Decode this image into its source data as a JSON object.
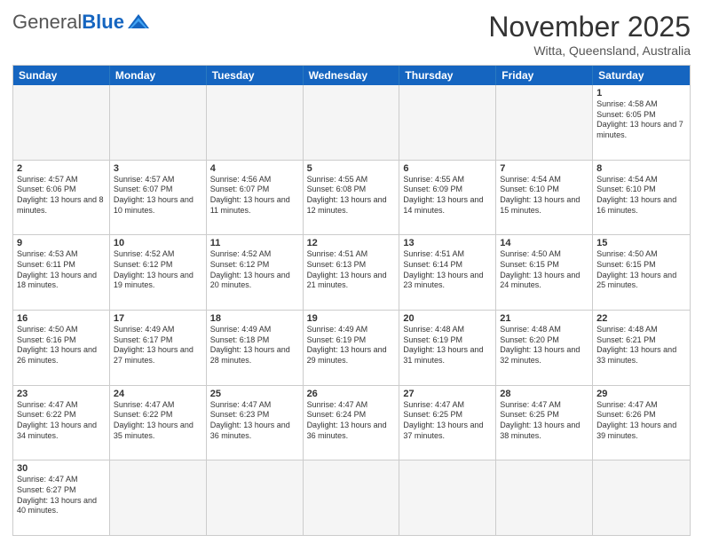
{
  "header": {
    "logo": {
      "general": "General",
      "blue": "Blue"
    },
    "title": "November 2025",
    "location": "Witta, Queensland, Australia"
  },
  "days_of_week": [
    "Sunday",
    "Monday",
    "Tuesday",
    "Wednesday",
    "Thursday",
    "Friday",
    "Saturday"
  ],
  "weeks": [
    [
      {
        "num": "",
        "info": "",
        "empty": true
      },
      {
        "num": "",
        "info": "",
        "empty": true
      },
      {
        "num": "",
        "info": "",
        "empty": true
      },
      {
        "num": "",
        "info": "",
        "empty": true
      },
      {
        "num": "",
        "info": "",
        "empty": true
      },
      {
        "num": "",
        "info": "",
        "empty": true
      },
      {
        "num": "1",
        "info": "Sunrise: 4:58 AM\nSunset: 6:05 PM\nDaylight: 13 hours and 7 minutes.",
        "empty": false
      }
    ],
    [
      {
        "num": "2",
        "info": "Sunrise: 4:57 AM\nSunset: 6:06 PM\nDaylight: 13 hours and 8 minutes.",
        "empty": false
      },
      {
        "num": "3",
        "info": "Sunrise: 4:57 AM\nSunset: 6:07 PM\nDaylight: 13 hours and 10 minutes.",
        "empty": false
      },
      {
        "num": "4",
        "info": "Sunrise: 4:56 AM\nSunset: 6:07 PM\nDaylight: 13 hours and 11 minutes.",
        "empty": false
      },
      {
        "num": "5",
        "info": "Sunrise: 4:55 AM\nSunset: 6:08 PM\nDaylight: 13 hours and 12 minutes.",
        "empty": false
      },
      {
        "num": "6",
        "info": "Sunrise: 4:55 AM\nSunset: 6:09 PM\nDaylight: 13 hours and 14 minutes.",
        "empty": false
      },
      {
        "num": "7",
        "info": "Sunrise: 4:54 AM\nSunset: 6:10 PM\nDaylight: 13 hours and 15 minutes.",
        "empty": false
      },
      {
        "num": "8",
        "info": "Sunrise: 4:54 AM\nSunset: 6:10 PM\nDaylight: 13 hours and 16 minutes.",
        "empty": false
      }
    ],
    [
      {
        "num": "9",
        "info": "Sunrise: 4:53 AM\nSunset: 6:11 PM\nDaylight: 13 hours and 18 minutes.",
        "empty": false
      },
      {
        "num": "10",
        "info": "Sunrise: 4:52 AM\nSunset: 6:12 PM\nDaylight: 13 hours and 19 minutes.",
        "empty": false
      },
      {
        "num": "11",
        "info": "Sunrise: 4:52 AM\nSunset: 6:12 PM\nDaylight: 13 hours and 20 minutes.",
        "empty": false
      },
      {
        "num": "12",
        "info": "Sunrise: 4:51 AM\nSunset: 6:13 PM\nDaylight: 13 hours and 21 minutes.",
        "empty": false
      },
      {
        "num": "13",
        "info": "Sunrise: 4:51 AM\nSunset: 6:14 PM\nDaylight: 13 hours and 23 minutes.",
        "empty": false
      },
      {
        "num": "14",
        "info": "Sunrise: 4:50 AM\nSunset: 6:15 PM\nDaylight: 13 hours and 24 minutes.",
        "empty": false
      },
      {
        "num": "15",
        "info": "Sunrise: 4:50 AM\nSunset: 6:15 PM\nDaylight: 13 hours and 25 minutes.",
        "empty": false
      }
    ],
    [
      {
        "num": "16",
        "info": "Sunrise: 4:50 AM\nSunset: 6:16 PM\nDaylight: 13 hours and 26 minutes.",
        "empty": false
      },
      {
        "num": "17",
        "info": "Sunrise: 4:49 AM\nSunset: 6:17 PM\nDaylight: 13 hours and 27 minutes.",
        "empty": false
      },
      {
        "num": "18",
        "info": "Sunrise: 4:49 AM\nSunset: 6:18 PM\nDaylight: 13 hours and 28 minutes.",
        "empty": false
      },
      {
        "num": "19",
        "info": "Sunrise: 4:49 AM\nSunset: 6:19 PM\nDaylight: 13 hours and 29 minutes.",
        "empty": false
      },
      {
        "num": "20",
        "info": "Sunrise: 4:48 AM\nSunset: 6:19 PM\nDaylight: 13 hours and 31 minutes.",
        "empty": false
      },
      {
        "num": "21",
        "info": "Sunrise: 4:48 AM\nSunset: 6:20 PM\nDaylight: 13 hours and 32 minutes.",
        "empty": false
      },
      {
        "num": "22",
        "info": "Sunrise: 4:48 AM\nSunset: 6:21 PM\nDaylight: 13 hours and 33 minutes.",
        "empty": false
      }
    ],
    [
      {
        "num": "23",
        "info": "Sunrise: 4:47 AM\nSunset: 6:22 PM\nDaylight: 13 hours and 34 minutes.",
        "empty": false
      },
      {
        "num": "24",
        "info": "Sunrise: 4:47 AM\nSunset: 6:22 PM\nDaylight: 13 hours and 35 minutes.",
        "empty": false
      },
      {
        "num": "25",
        "info": "Sunrise: 4:47 AM\nSunset: 6:23 PM\nDaylight: 13 hours and 36 minutes.",
        "empty": false
      },
      {
        "num": "26",
        "info": "Sunrise: 4:47 AM\nSunset: 6:24 PM\nDaylight: 13 hours and 36 minutes.",
        "empty": false
      },
      {
        "num": "27",
        "info": "Sunrise: 4:47 AM\nSunset: 6:25 PM\nDaylight: 13 hours and 37 minutes.",
        "empty": false
      },
      {
        "num": "28",
        "info": "Sunrise: 4:47 AM\nSunset: 6:25 PM\nDaylight: 13 hours and 38 minutes.",
        "empty": false
      },
      {
        "num": "29",
        "info": "Sunrise: 4:47 AM\nSunset: 6:26 PM\nDaylight: 13 hours and 39 minutes.",
        "empty": false
      }
    ],
    [
      {
        "num": "30",
        "info": "Sunrise: 4:47 AM\nSunset: 6:27 PM\nDaylight: 13 hours and 40 minutes.",
        "empty": false
      },
      {
        "num": "",
        "info": "",
        "empty": true
      },
      {
        "num": "",
        "info": "",
        "empty": true
      },
      {
        "num": "",
        "info": "",
        "empty": true
      },
      {
        "num": "",
        "info": "",
        "empty": true
      },
      {
        "num": "",
        "info": "",
        "empty": true
      },
      {
        "num": "",
        "info": "",
        "empty": true
      }
    ]
  ]
}
